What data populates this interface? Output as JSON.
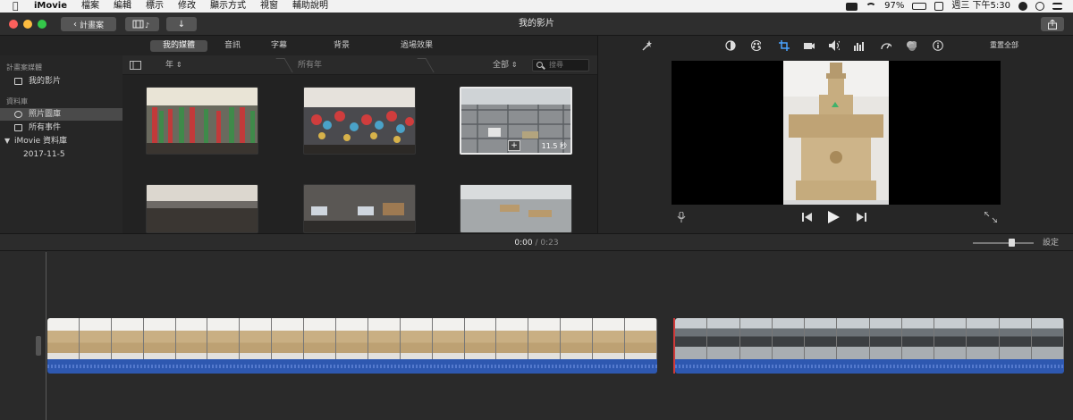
{
  "menubar": {
    "app_name": "iMovie",
    "menus": [
      "檔案",
      "編輯",
      "標示",
      "修改",
      "顯示方式",
      "視窗",
      "輔助說明"
    ],
    "battery": "97%",
    "clock": "週三 下午5:30"
  },
  "toolbar": {
    "projects_label": "計畫案",
    "window_title": "我的影片"
  },
  "tabs": [
    "我的媒體",
    "音訊",
    "字幕",
    "背景",
    "過場效果"
  ],
  "sidebar": {
    "projects_header": "計畫案媒體",
    "my_movie": "我的影片",
    "libraries_header": "資料庫",
    "photos_library": "照片圖庫",
    "all_events": "所有事件",
    "imovie_library": "iMovie 資料庫",
    "event_date": "2017-11-5"
  },
  "filterbar": {
    "year_label": "年",
    "all_years": "所有年",
    "filter": "全部",
    "search_placeholder": "搜尋"
  },
  "browser": {
    "selected_duration": "11.5 秒"
  },
  "inspector": {
    "reset_all": "重置全部"
  },
  "timeline": {
    "current": "0:00",
    "separator": "/",
    "total": "0:23",
    "settings": "設定"
  }
}
